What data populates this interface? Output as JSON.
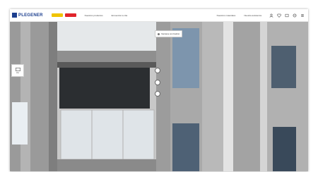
{
  "header": {
    "logo_text": "PLEGENER",
    "badge_yellow": "",
    "badge_red": "",
    "nav": [
      "Nuestros productos",
      "Encuentra tu cita"
    ],
    "nav_right": [
      "Nuestros materiales",
      "Nuestra asistencia"
    ],
    "icons": [
      "user-icon",
      "heart-icon",
      "cart-icon",
      "globe-icon",
      "menu-icon"
    ]
  },
  "tooltip": {
    "label": "Ventana con balcón"
  },
  "side_tab": {
    "label": "Ver"
  },
  "colors": {
    "brand": "#1c3f8f",
    "accent_yellow": "#f0c400",
    "accent_red": "#e0242b"
  }
}
